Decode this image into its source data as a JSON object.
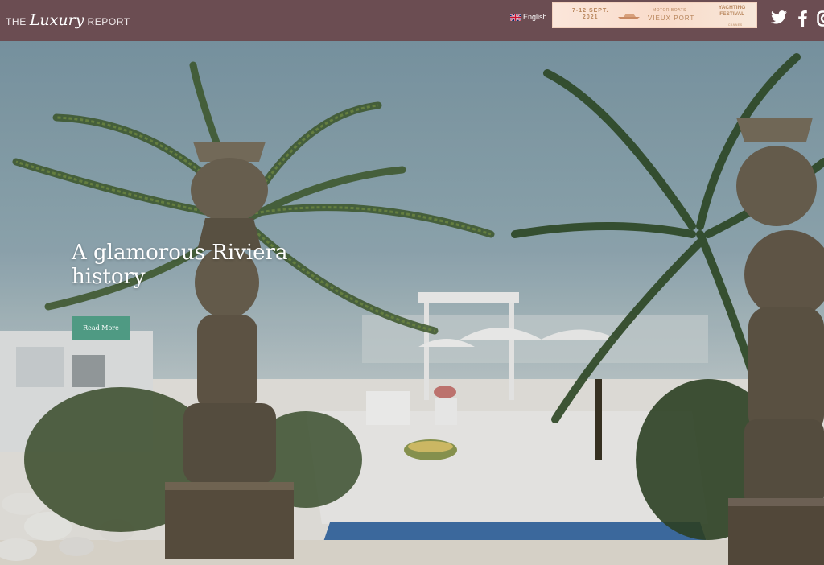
{
  "header": {
    "logo": {
      "prefix": "THE",
      "script": "Luxury",
      "suffix": "REPORT"
    },
    "language": {
      "label": "English",
      "flag_icon": "uk-flag-icon"
    },
    "banner": {
      "dates": "7-12 SEPT.",
      "year": "2021",
      "line1": "MOTOR BOATS",
      "line2": "VIEUX PORT",
      "brand1": "YACHTING",
      "brand2": "FESTIVAL",
      "city": "CANNES"
    },
    "social": [
      "twitter-icon",
      "facebook-icon",
      "instagram-icon"
    ]
  },
  "hero": {
    "title": "A glamorous Riviera history",
    "button_label": "Read More"
  },
  "colors": {
    "header_bg": "#6b4d52",
    "button_bg": "#4f9a83",
    "banner_text": "#b8865c"
  }
}
